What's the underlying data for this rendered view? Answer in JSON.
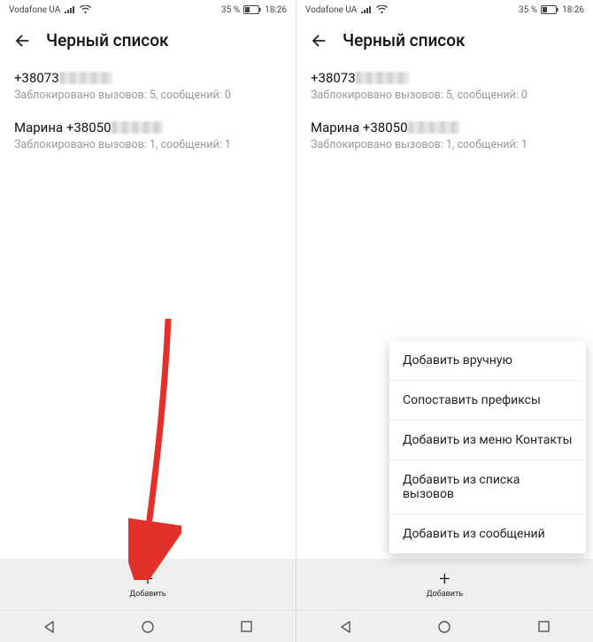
{
  "status": {
    "carrier": "Vodafone UA",
    "battery_text": "35 %",
    "time": "18:26"
  },
  "header": {
    "title": "Черный список"
  },
  "entries": [
    {
      "prefix": "+38073",
      "stats": "Заблокировано вызовов: 5, сообщений: 0"
    },
    {
      "prefix": "Марина +38050",
      "stats": "Заблокировано вызовов: 1, сообщений: 1"
    }
  ],
  "add_button": {
    "label": "Добавить"
  },
  "popup": {
    "options": [
      "Добавить вручную",
      "Сопоставить префиксы",
      "Добавить из меню Контакты",
      "Добавить из списка вызовов",
      "Добавить из сообщений"
    ]
  }
}
